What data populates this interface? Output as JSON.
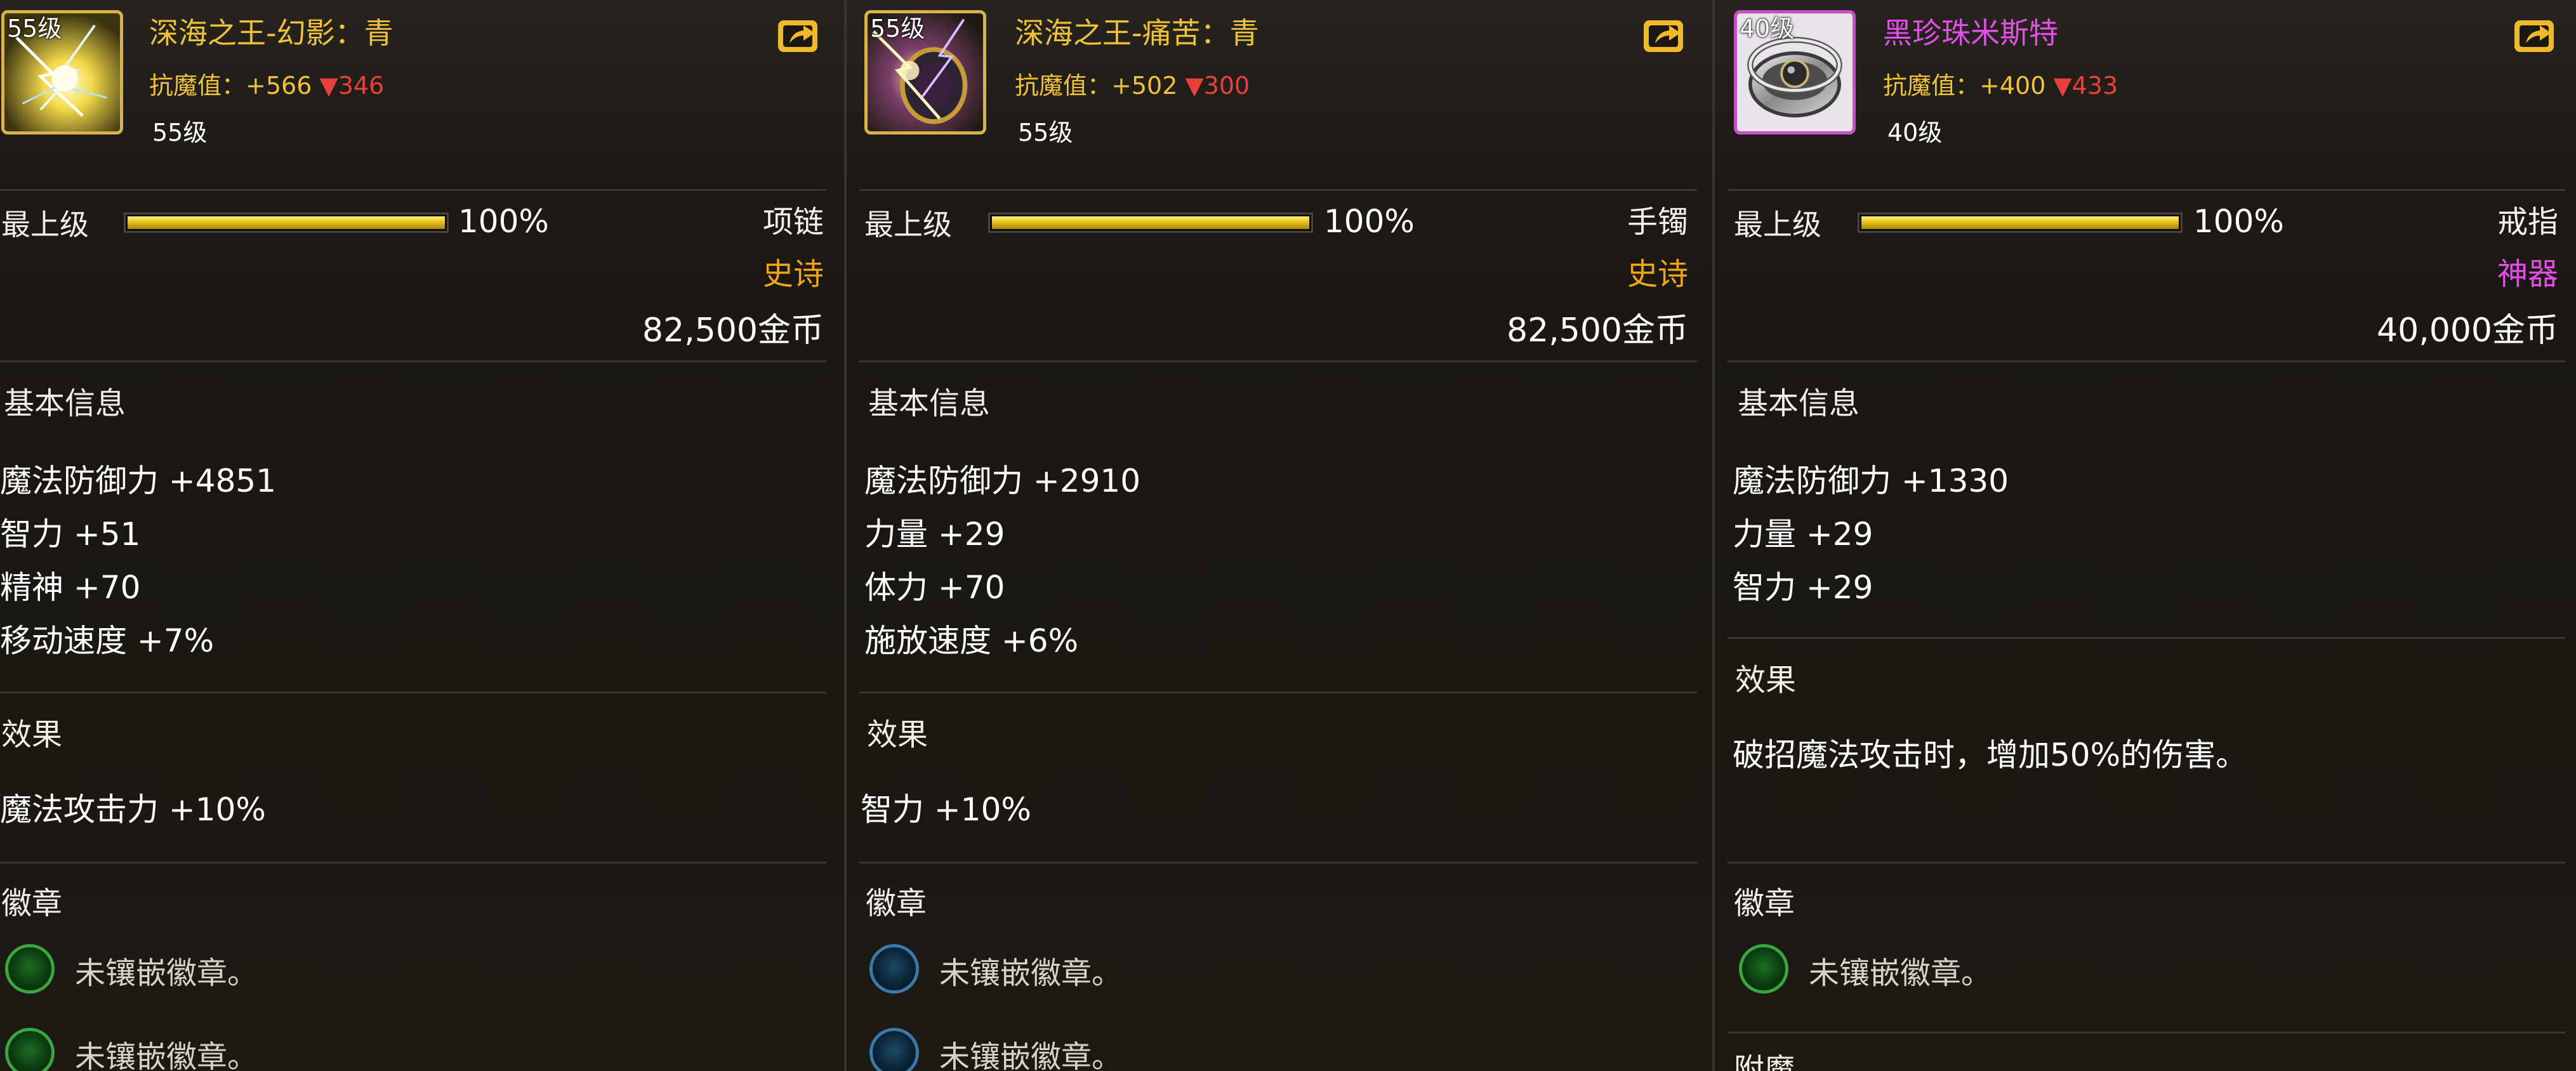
{
  "panels": [
    {
      "level_badge": "55级",
      "name": "深海之王-幻影：青",
      "resist_label": "抗魔值：+566",
      "resist_diff": "▼346",
      "req_level": "55级",
      "grade": "最上级",
      "progress_pct": 100,
      "progress_text": "100%",
      "slot": "项链",
      "rarity": "史诗",
      "price": "82,500金币",
      "basic_title": "基本信息",
      "stats": [
        "魔法防御力 +4851",
        "智力 +51",
        "精神 +70",
        "移动速度 +7%"
      ],
      "effect_title": "效果",
      "effect": "魔法攻击力 +10%",
      "emblem_title": "徽章",
      "emblems": [
        "未镶嵌徽章。",
        "未镶嵌徽章。"
      ],
      "emblem_color": "green"
    },
    {
      "level_badge": "55级",
      "name": "深海之王-痛苦：青",
      "resist_label": "抗魔值：+502",
      "resist_diff": "▼300",
      "req_level": "55级",
      "grade": "最上级",
      "progress_pct": 100,
      "progress_text": "100%",
      "slot": "手镯",
      "rarity": "史诗",
      "price": "82,500金币",
      "basic_title": "基本信息",
      "stats": [
        "魔法防御力 +2910",
        "力量 +29",
        "体力 +70",
        "施放速度 +6%"
      ],
      "effect_title": "效果",
      "effect": "智力 +10%",
      "emblem_title": "徽章",
      "emblems": [
        "未镶嵌徽章。",
        "未镶嵌徽章。"
      ],
      "emblem_color": "blue"
    },
    {
      "level_badge": "40级",
      "name": "黑珍珠米斯特",
      "resist_label": "抗魔值：+400",
      "resist_diff": "▼433",
      "req_level": "40级",
      "grade": "最上级",
      "progress_pct": 100,
      "progress_text": "100%",
      "slot": "戒指",
      "rarity": "神器",
      "price": "40,000金币",
      "basic_title": "基本信息",
      "stats": [
        "魔法防御力 +1330",
        "力量 +29",
        "智力 +29"
      ],
      "effect_title": "效果",
      "effect": "破招魔法攻击时，增加50%的伤害。",
      "emblem_title": "徽章",
      "emblems": [
        "未镶嵌徽章。"
      ],
      "emblem_color": "green",
      "enchant_title": "附魔"
    }
  ],
  "colors": {
    "gold_text": "#f0c23a",
    "epic": "#f0a418",
    "artifact": "#e14fe6",
    "decrease": "#e8403a"
  }
}
